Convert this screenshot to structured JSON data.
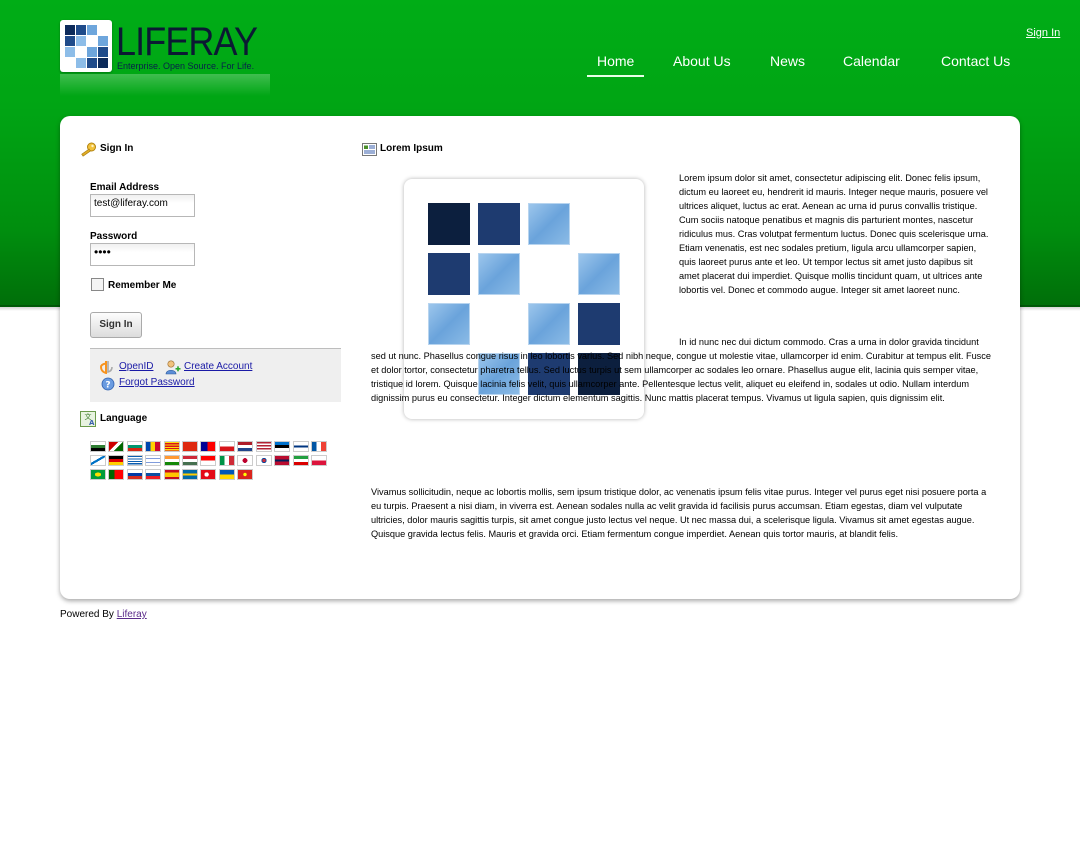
{
  "header": {
    "logo_text": "LIFERAY",
    "logo_tagline": "Enterprise. Open Source. For Life.",
    "sign_in_link": "Sign In",
    "nav": [
      "Home",
      "About Us",
      "News",
      "Calendar",
      "Contact Us"
    ],
    "active_nav": "Home"
  },
  "signin_portlet": {
    "title": "Sign In",
    "email_label": "Email Address",
    "email_value": "test@liferay.com",
    "password_label": "Password",
    "password_value": "••••",
    "remember_label": "Remember Me",
    "button_label": "Sign In",
    "openid_link": "OpenID",
    "create_account_link": "Create Account",
    "forgot_password_link": "Forgot Password"
  },
  "language_portlet": {
    "title": "Language"
  },
  "lorem_portlet": {
    "title": "Lorem Ipsum",
    "paragraphs": [
      "Lorem ipsum dolor sit amet, consectetur adipiscing elit. Donec felis ipsum, dictum eu laoreet eu, hendrerit id mauris. Integer neque mauris, posuere vel ultrices aliquet, luctus ac erat. Aenean ac urna id purus convallis tristique. Cum sociis natoque penatibus et magnis dis parturient montes, nascetur ridiculus mus. Cras volutpat fermentum luctus. Donec quis scelerisque urna. Etiam venenatis, est nec sodales pretium, ligula arcu ullamcorper sapien, quis laoreet purus ante et leo. Ut tempor lectus sit amet justo dapibus sit amet placerat dui imperdiet. Quisque mollis tincidunt quam, ut ultrices ante lobortis vel. Donec et commodo augue. Integer sit amet laoreet nunc.",
      "In id nunc nec dui dictum commodo. Cras a urna in dolor gravida tincidunt sed ut nunc. Phasellus congue risus in leo lobortis varius. Sed nibh neque, congue ut molestie vitae, ullamcorper id enim. Curabitur at tempus elit. Fusce et dolor tortor, consectetur pharetra tellus. Sed luctus turpis ut sem ullamcorper ac sodales leo ornare. Phasellus augue elit, lacinia quis semper vitae, tristique id lorem. Quisque lacinia felis velit, quis ullamcorper ante. Pellentesque lectus velit, aliquet eu eleifend in, sodales ut odio. Nullam interdum dignissim purus eu consectetur. Integer dictum elementum sagittis. Nunc mattis placerat tempus. Vivamus ut ligula sapien, quis dignissim elit.",
      "Vivamus sollicitudin, neque ac lobortis mollis, sem ipsum tristique dolor, ac venenatis ipsum felis vitae purus. Integer vel purus eget nisi posuere porta a eu turpis. Praesent a nisi diam, in viverra est. Aenean sodales nulla ac velit gravida id facilisis purus accumsan. Etiam egestas, diam vel vulputate ultricies, dolor mauris sagittis turpis, sit amet congue justo lectus vel neque. Ut nec massa dui, a scelerisque ligula. Vivamus sit amet egestas augue. Quisque gravida lectus felis. Mauris et gravida orci. Etiam fermentum congue imperdiet. Aenean quis tortor mauris, at blandit felis."
    ]
  },
  "footer": {
    "powered_by": "Powered By",
    "liferay_link": "Liferay"
  },
  "colors": {
    "header_green": "#00a514",
    "link_blue": "#1a1aa6"
  }
}
